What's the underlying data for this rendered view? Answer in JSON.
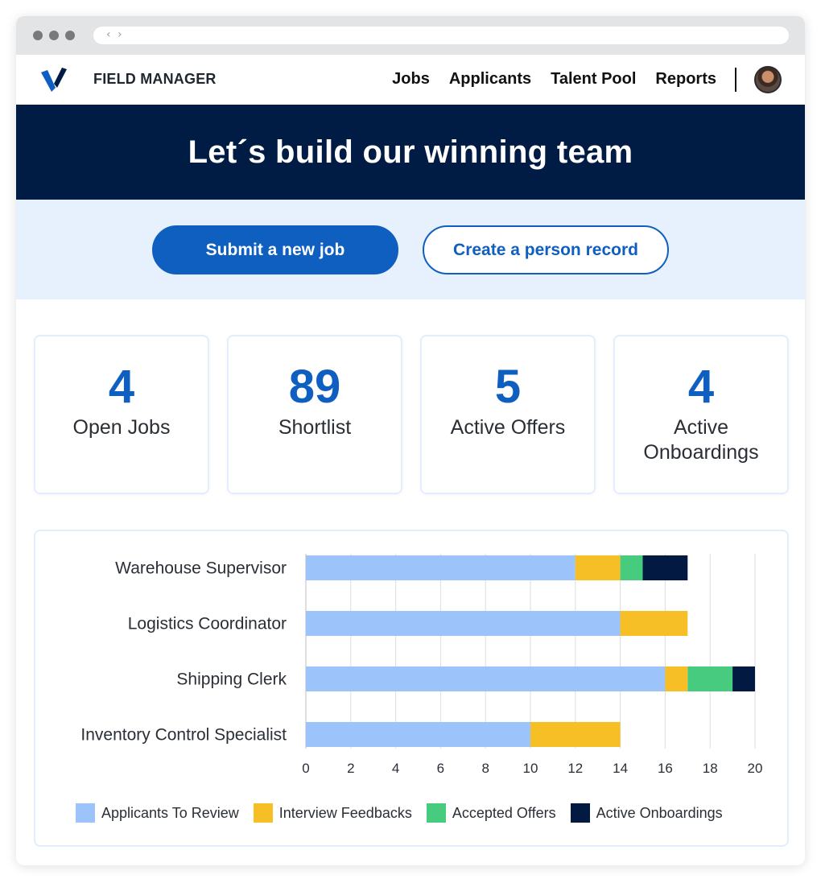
{
  "app": {
    "brand": "FIELD MANAGER"
  },
  "nav": {
    "items": [
      {
        "label": "Jobs"
      },
      {
        "label": "Applicants"
      },
      {
        "label": "Talent Pool"
      },
      {
        "label": "Reports"
      }
    ]
  },
  "hero": {
    "title": "Let´s build our winning team"
  },
  "actions": {
    "primary_label": "Submit a new job",
    "secondary_label": "Create a person record"
  },
  "stats": [
    {
      "value": "4",
      "label": "Open Jobs"
    },
    {
      "value": "89",
      "label": "Shortlist"
    },
    {
      "value": "5",
      "label": "Active Offers"
    },
    {
      "value": "4",
      "label": "Active Onboardings"
    }
  ],
  "colors": {
    "accent": "#0f5fc0",
    "navy": "#001b44",
    "light_panel": "#e7f1fd"
  },
  "icons": {
    "logo": "v-logo-icon",
    "avatar": "user-avatar",
    "browser_nav": "back-forward-icon"
  },
  "chart_data": {
    "type": "bar",
    "orientation": "horizontal",
    "stacked": true,
    "categories": [
      "Warehouse Supervisor",
      "Logistics Coordinator",
      "Shipping Clerk",
      "Inventory Control Specialist"
    ],
    "series": [
      {
        "name": "Applicants To Review",
        "color": "#9cc4fb",
        "values": [
          12,
          14,
          16,
          10
        ]
      },
      {
        "name": "Interview Feedbacks",
        "color": "#f5bf25",
        "values": [
          2,
          3,
          1,
          4
        ]
      },
      {
        "name": "Accepted Offers",
        "color": "#47cc7f",
        "values": [
          1,
          0,
          2,
          0
        ]
      },
      {
        "name": "Active Onboardings",
        "color": "#021a42",
        "values": [
          2,
          0,
          1,
          0
        ]
      }
    ],
    "xlim": [
      0,
      20
    ],
    "xticks": [
      0,
      2,
      4,
      6,
      8,
      10,
      12,
      14,
      16,
      18,
      20
    ],
    "grid": "vertical",
    "legend_position": "bottom"
  }
}
